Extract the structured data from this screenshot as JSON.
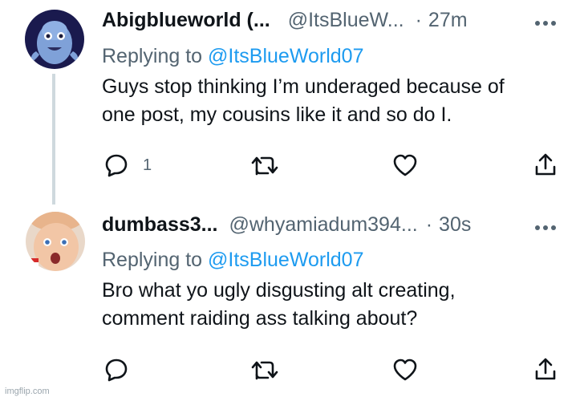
{
  "tweets": [
    {
      "author_name": "Abigblueworld (...",
      "handle": "@ItsBlueW...",
      "dot": "·",
      "time": "27m",
      "replying_label": "Replying to",
      "replying_to": "@ItsBlueWorld07",
      "text_lines": [
        "Guys stop thinking I’m underaged because of",
        "one post, my cousins like it and so do I."
      ],
      "reply_count": "1"
    },
    {
      "author_name": "dumbass3...",
      "handle": "@whyamiadum394...",
      "dot": "·",
      "time": "30s",
      "replying_label": "Replying to",
      "replying_to": "@ItsBlueWorld07",
      "text_lines": [
        "Bro what yo ugly disgusting alt creating,",
        "comment raiding ass talking about?"
      ],
      "reply_count": ""
    }
  ],
  "icons": [
    "more-icon",
    "reply-icon",
    "retweet-icon",
    "like-icon",
    "share-icon"
  ],
  "colors": {
    "text": "#0f1419",
    "secondary": "#536471",
    "link": "#1d9bf0",
    "thread_line": "#cfd9de"
  },
  "watermark": "imgflip.com"
}
